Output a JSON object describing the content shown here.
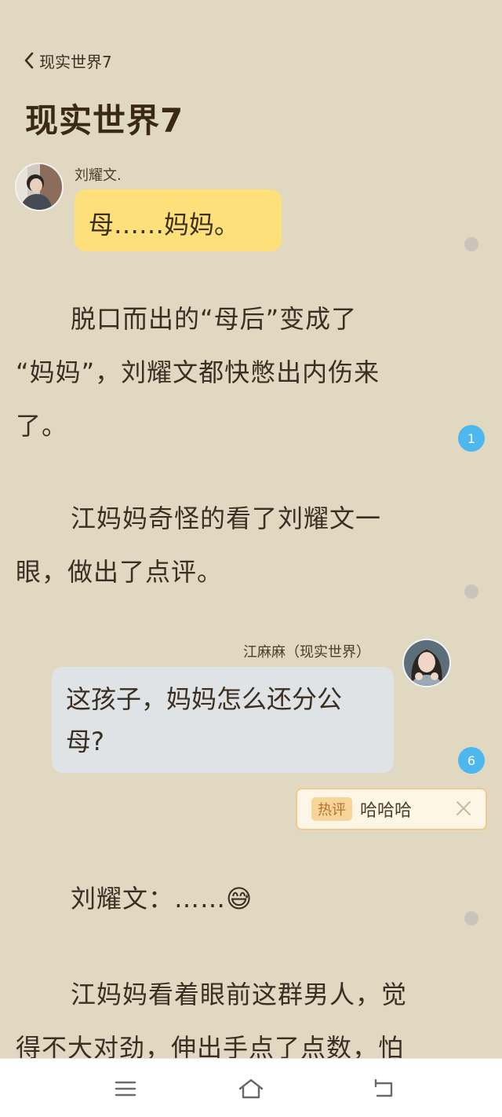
{
  "header": {
    "back_label": "现实世界7",
    "title": "现实世界7"
  },
  "messages": [
    {
      "speaker": "刘耀文.",
      "text": "母……妈妈。",
      "side": "left"
    },
    {
      "speaker": "江麻麻（现实世界）",
      "text_line1": "这孩子，妈妈怎么还分公",
      "text_line2": "母?",
      "side": "right"
    }
  ],
  "paragraphs": [
    {
      "line1": "脱口而出的“母后”变成了",
      "line2": "“妈妈”，刘耀文都快憋出内伤来",
      "line3": "了。"
    },
    {
      "line1": "江妈妈奇怪的看了刘耀文一",
      "line2": "眼，做出了点评。"
    },
    {
      "line1": "刘耀文：……😅"
    },
    {
      "line1": "江妈妈看着眼前这群男人，觉",
      "line2": "得不大对劲，伸出手点了点数，怕"
    }
  ],
  "comment_counts": {
    "para1": "1",
    "bubble2": "6"
  },
  "hot_comment": {
    "tag": "热评",
    "text": "哈哈哈"
  },
  "colors": {
    "background": "#e1d8c1",
    "bubble_left": "#fde07a",
    "bubble_right": "#e0e3e6",
    "count_badge": "#4db7ee",
    "hot_border": "#f4c98f"
  },
  "icons": [
    "chevron-left-icon",
    "close-icon",
    "menu-icon",
    "home-icon",
    "back-icon"
  ]
}
